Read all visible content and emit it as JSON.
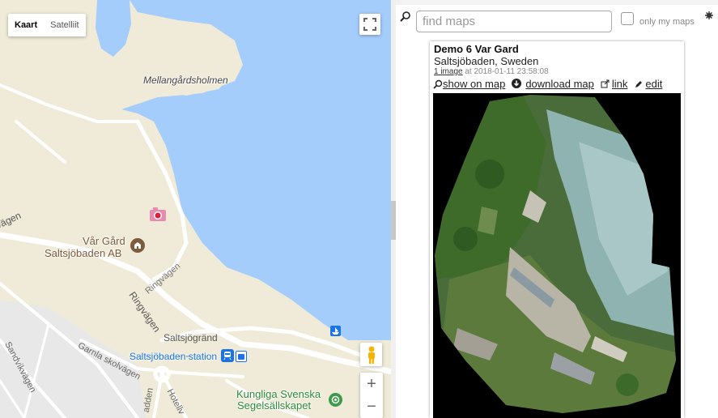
{
  "map": {
    "map_type_buttons": [
      "Kaart",
      "Satelliit"
    ],
    "active_map_type": "Kaart",
    "labels": {
      "island": "Mellangårdsholmen",
      "poi_name_line1": "Vår Gård",
      "poi_name_line2": "Saltsjöbaden AB",
      "road_ringvagen_1": "Ringvägen",
      "road_ringvagen_2": "Ringvägen",
      "road_saltsjogrand": "Saltsjögränd",
      "road_vagen": "vägen",
      "station": "Saltsjöbaden station",
      "road_sandvikvagen": "Sandvikvägen",
      "road_garnla": "Garnla skolvägen",
      "road_adden": "adden",
      "road_hotellv": "Hotellv",
      "club_line1": "Kungliga Svenska",
      "club_line2": "Segelsällskapet"
    },
    "zoom_in": "+",
    "zoom_out": "−",
    "colors": {
      "water": "#a4cdfb",
      "land": "#efebd8",
      "urban": "#e8e8e8",
      "road": "#ffffff",
      "poi": "#7e5b3c",
      "transit": "#1a73e8",
      "park": "#3c9a4a"
    }
  },
  "panel": {
    "search": {
      "placeholder": "find maps",
      "value": ""
    },
    "only_mine_label": "only my maps",
    "card": {
      "title": "Demo 6 Var Gard",
      "location": "Saltsjöbaden, Sweden",
      "image_count": "1 image",
      "meta_text": " at 2018-01-11 23:58:08",
      "actions": {
        "show_on_map": "show on map",
        "download_map": "download map",
        "link": "link",
        "edit": "edit"
      }
    }
  },
  "icons": [
    "search-icon",
    "gear-icon",
    "fullscreen-icon",
    "pegman-icon",
    "camera-marker-icon",
    "poi-icon",
    "train-icon",
    "bus-icon",
    "boat-icon",
    "park-icon",
    "magnify-icon",
    "download-icon",
    "external-link-icon",
    "pencil-icon"
  ]
}
